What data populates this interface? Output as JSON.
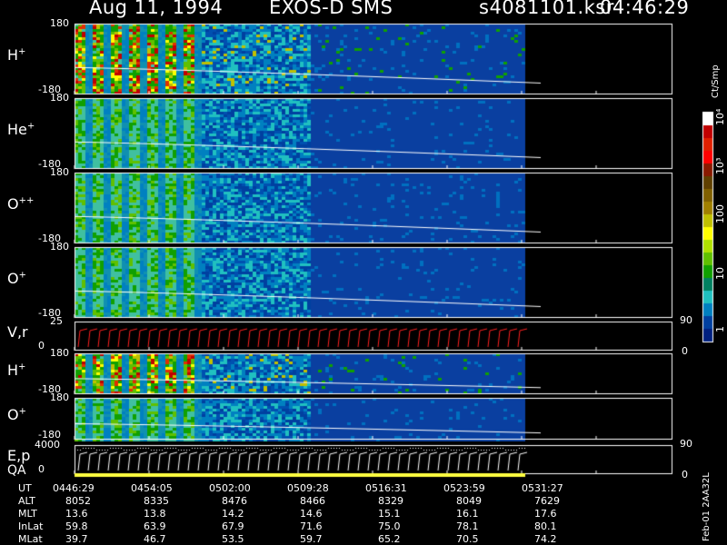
{
  "header": {
    "date": "Aug 11, 1994",
    "mission": "EXOS-D SMS",
    "file": "s4081101.ksr",
    "time": "04:46:29"
  },
  "colorbar": {
    "unit": "Ct/Smp",
    "tick_labels": [
      "10⁴",
      "10³",
      "100",
      "10",
      "1"
    ],
    "colors": [
      "#ffffff",
      "#c00000",
      "#e02000",
      "#ff0000",
      "#8a1a00",
      "#604000",
      "#806000",
      "#a08000",
      "#c0c000",
      "#ffff00",
      "#b0e000",
      "#60c000",
      "#10a000",
      "#008060",
      "#20c0c0",
      "#0080c0",
      "#0040a0",
      "#002080"
    ]
  },
  "footer": {
    "row_labels": [
      "UT",
      "ALT",
      "MLT",
      "InLat",
      "MLat"
    ],
    "columns": [
      [
        "0446:29",
        "8052",
        "13.6",
        "59.8",
        "39.7"
      ],
      [
        "0454:05",
        "8335",
        "13.8",
        "63.9",
        "46.7"
      ],
      [
        "0502:00",
        "8476",
        "14.2",
        "67.9",
        "53.5"
      ],
      [
        "0509:28",
        "8466",
        "14.6",
        "71.6",
        "59.7"
      ],
      [
        "0516:31",
        "8329",
        "15.1",
        "75.0",
        "65.2"
      ],
      [
        "0523:59",
        "8049",
        "16.1",
        "78.1",
        "70.5"
      ],
      [
        "0531:27",
        "7629",
        "17.6",
        "80.1",
        "74.2"
      ]
    ],
    "creation_stamp": "Feb-01 2AA32L"
  },
  "chart_data": {
    "type": "heatmap",
    "title": "Aug 11, 1994   EXOS-D SMS",
    "x_ticks": [
      "0446:29",
      "0454:05",
      "0502:00",
      "0509:28",
      "0516:31",
      "0523:59",
      "0531:27"
    ],
    "panels": [
      {
        "label": "H",
        "sup": "+",
        "kind": "spectrogram",
        "yticks": [
          "180",
          "-180"
        ]
      },
      {
        "label": "He",
        "sup": "+",
        "kind": "spectrogram",
        "yticks": [
          "180",
          "-180"
        ]
      },
      {
        "label": "O",
        "sup": "++",
        "kind": "spectrogram",
        "yticks": [
          "180",
          "-180"
        ]
      },
      {
        "label": "O",
        "sup": "+",
        "kind": "spectrogram",
        "yticks": [
          "180",
          "-180"
        ]
      },
      {
        "label": "V,r",
        "sup": "",
        "kind": "line",
        "yticks": [
          "25",
          "0"
        ],
        "right_ticks": [
          "90",
          "0"
        ]
      },
      {
        "label": "H",
        "sup": "+",
        "kind": "spectrogram",
        "yticks": [
          "180",
          "-180"
        ]
      },
      {
        "label": "O",
        "sup": "+",
        "kind": "spectrogram",
        "yticks": [
          "180",
          "-180"
        ]
      },
      {
        "label": "E,p",
        "sup": "",
        "kind": "line",
        "yticks": [
          "4000",
          "0"
        ],
        "right_ticks": [
          "90",
          "0"
        ]
      }
    ],
    "qa_label": "QA"
  }
}
